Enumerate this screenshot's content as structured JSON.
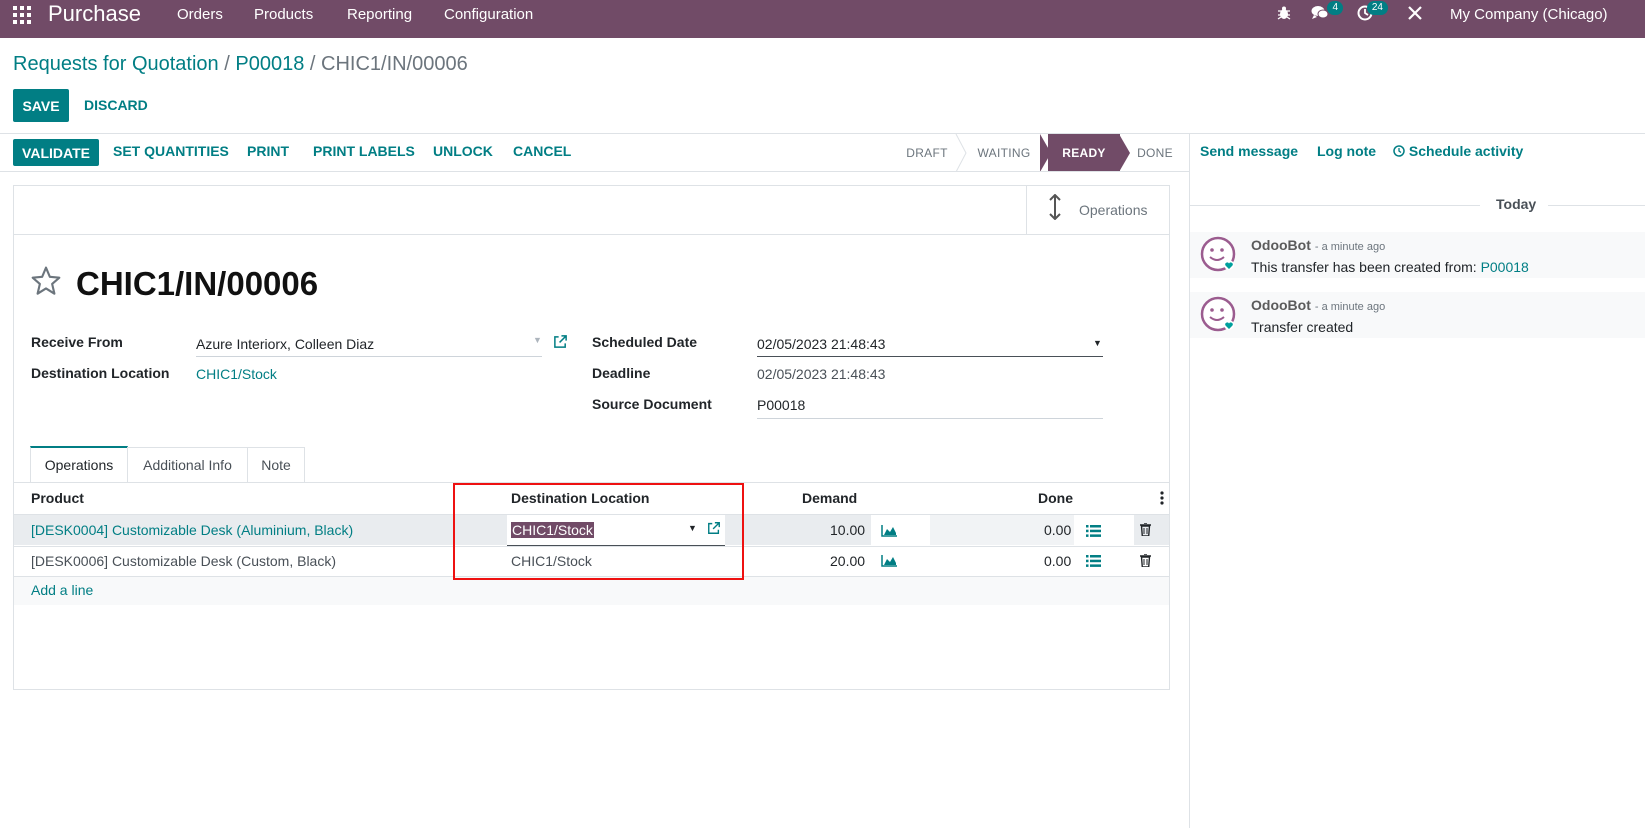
{
  "navbar": {
    "app_name": "Purchase",
    "menus": [
      "Orders",
      "Products",
      "Reporting",
      "Configuration"
    ],
    "messages_count": "4",
    "activities_count": "24",
    "company": "My Company (Chicago)"
  },
  "breadcrumb": {
    "items": [
      "Requests for Quotation",
      "P00018"
    ],
    "separator": "/",
    "current": "CHIC1/IN/00006"
  },
  "actions": {
    "save": "SAVE",
    "discard": "DISCARD"
  },
  "header_buttons": {
    "validate": "VALIDATE",
    "set_quantities": "SET QUANTITIES",
    "print": "PRINT",
    "print_labels": "PRINT LABELS",
    "unlock": "UNLOCK",
    "cancel": "CANCEL"
  },
  "status": {
    "stages": [
      "DRAFT",
      "WAITING",
      "READY",
      "DONE"
    ],
    "active": "READY"
  },
  "smart_button": {
    "label": "Operations"
  },
  "record": {
    "title": "CHIC1/IN/00006",
    "receive_from_label": "Receive From",
    "receive_from": "Azure Interiorx, Colleen Diaz",
    "destination_label": "Destination Location",
    "destination": "CHIC1/Stock",
    "scheduled_date_label": "Scheduled Date",
    "scheduled_date": "02/05/2023 21:48:43",
    "deadline_label": "Deadline",
    "deadline": "02/05/2023 21:48:43",
    "source_document_label": "Source Document",
    "source_document": "P00018"
  },
  "tabs": [
    "Operations",
    "Additional Info",
    "Note"
  ],
  "table": {
    "headers": [
      "Product",
      "Destination Location",
      "Demand",
      "Done"
    ],
    "rows": [
      {
        "product": "[DESK0004] Customizable Desk (Aluminium, Black)",
        "destination": "CHIC1/Stock",
        "demand": "10.00",
        "done": "0.00"
      },
      {
        "product": "[DESK0006] Customizable Desk (Custom, Black)",
        "destination": "CHIC1/Stock",
        "demand": "20.00",
        "done": "0.00"
      }
    ],
    "add_line": "Add a line"
  },
  "chatter": {
    "send_message": "Send message",
    "log_note": "Log note",
    "schedule_activity": "Schedule activity",
    "date_separator": "Today",
    "messages": [
      {
        "author": "OdooBot",
        "time": "- a minute ago",
        "body": "This transfer has been created from:",
        "link": "P00018"
      },
      {
        "author": "OdooBot",
        "time": "- a minute ago",
        "body": "Transfer created"
      }
    ]
  },
  "colors": {
    "brand": "#714B67",
    "accent": "#017e84",
    "highlight_box": "#ee1111"
  }
}
